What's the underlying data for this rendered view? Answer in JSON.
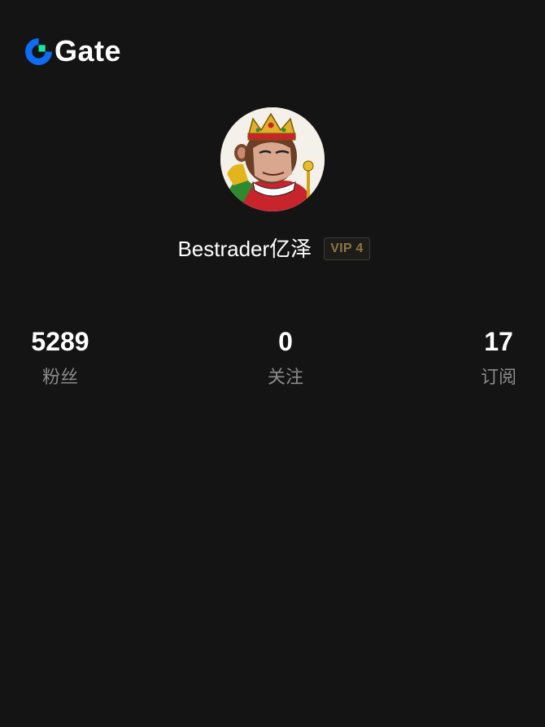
{
  "brand": {
    "name": "Gate",
    "icon": "gate-logo-icon",
    "accent": "#0f6cf5",
    "accent_secondary": "#17e6a1"
  },
  "profile": {
    "avatar": "ape-king-avatar",
    "username": "Bestrader亿泽",
    "vip_badge": "VIP 4",
    "vip_color": "#8a7546"
  },
  "stats": [
    {
      "value": "5289",
      "label": "粉丝"
    },
    {
      "value": "0",
      "label": "关注"
    },
    {
      "value": "17",
      "label": "订阅"
    }
  ],
  "colors": {
    "background": "#141414",
    "text_primary": "#ffffff",
    "text_secondary": "#8b8b8b"
  }
}
